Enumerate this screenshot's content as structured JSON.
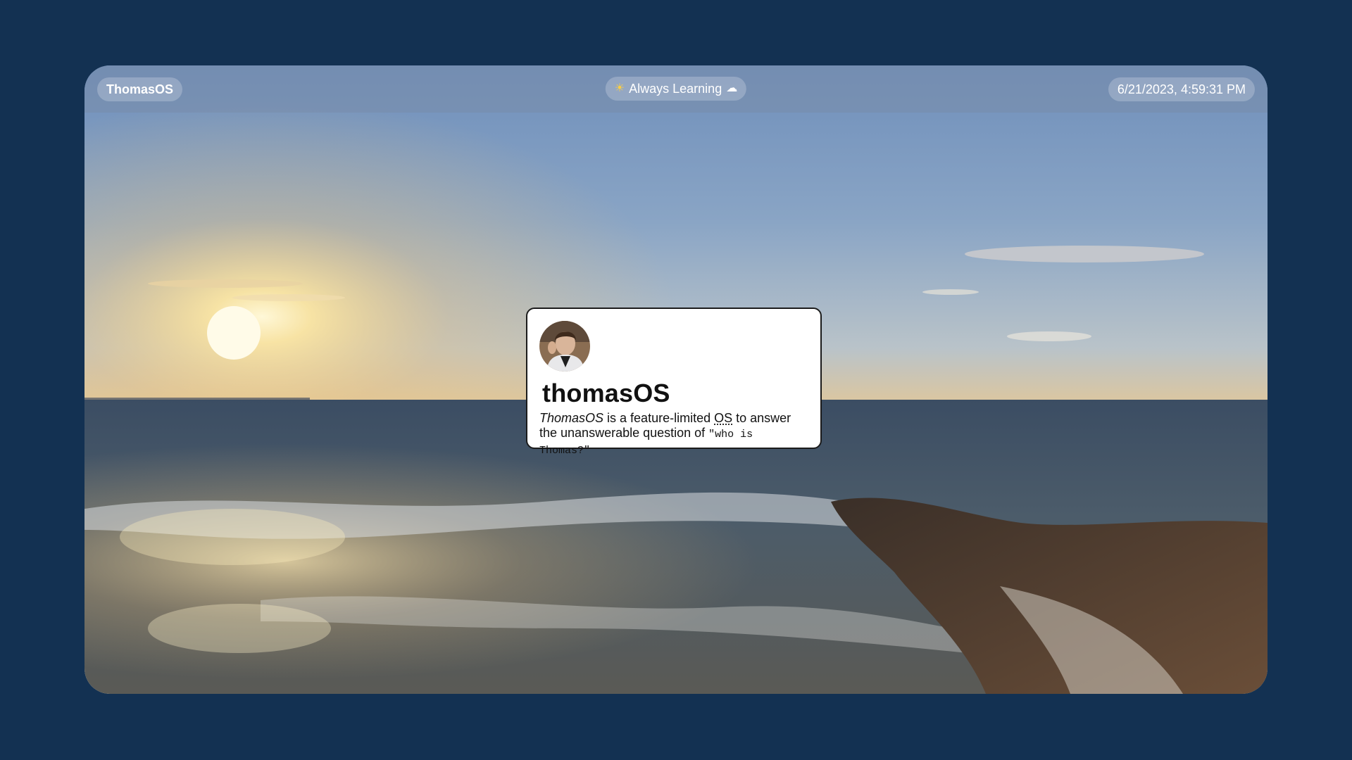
{
  "menubar": {
    "brand": "ThomasOS",
    "status": {
      "left_icon": "sun-icon",
      "text": "Always Learning",
      "right_icon": "cloud-icon"
    },
    "datetime": "6/21/2023, 4:59:31 PM"
  },
  "about_card": {
    "title": "thomasOS",
    "desc_italic": "ThomasOS",
    "desc_mid": " is a feature-limited ",
    "desc_abbr": "OS",
    "desc_after": " to answer the unanswerable question of ",
    "desc_code": "\"who is Thomas?\""
  },
  "colors": {
    "background": "#133152",
    "card": "#ffffff",
    "menubar_text": "#ffffff"
  }
}
